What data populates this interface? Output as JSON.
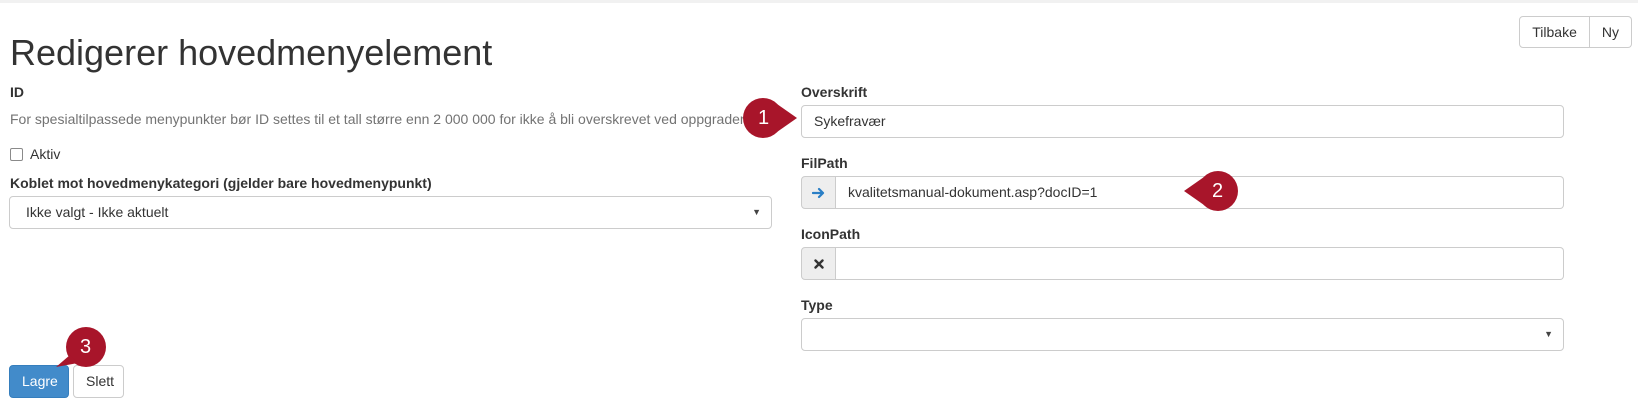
{
  "header": {
    "title": "Redigerer hovedmenyelement",
    "back_label": "Tilbake",
    "new_label": "Ny"
  },
  "left": {
    "id_label": "ID",
    "id_help": "For spesialtilpassede menypunkter bør ID settes til et tall større enn 2 000 000 for ikke å bli overskrevet ved oppgradering.",
    "active_label": "Aktiv",
    "active_checked": false,
    "category_label": "Koblet mot hovedmenykategori (gjelder bare hovedmenypunkt)",
    "category_value": "Ikke valgt - Ikke aktuelt"
  },
  "right": {
    "heading_label": "Overskrift",
    "heading_value": "Sykefravær",
    "filepath_label": "FilPath",
    "filepath_value": "kvalitetsmanual-dokument.asp?docID=1",
    "iconpath_label": "IconPath",
    "iconpath_value": "",
    "type_label": "Type",
    "type_value": ""
  },
  "footer": {
    "save_label": "Lagre",
    "delete_label": "Slett"
  },
  "annotations": {
    "marker_1": "1",
    "marker_2": "2",
    "marker_3": "3"
  },
  "colors": {
    "primary": "#428bca",
    "marker": "#a8152a",
    "text": "#333333",
    "muted": "#737373",
    "arrow_icon": "#2a7fc6"
  },
  "icons": {
    "filepath_addon": "arrow-right-icon",
    "iconpath_addon": "close-icon",
    "select_caret": "caret-down-icon"
  }
}
